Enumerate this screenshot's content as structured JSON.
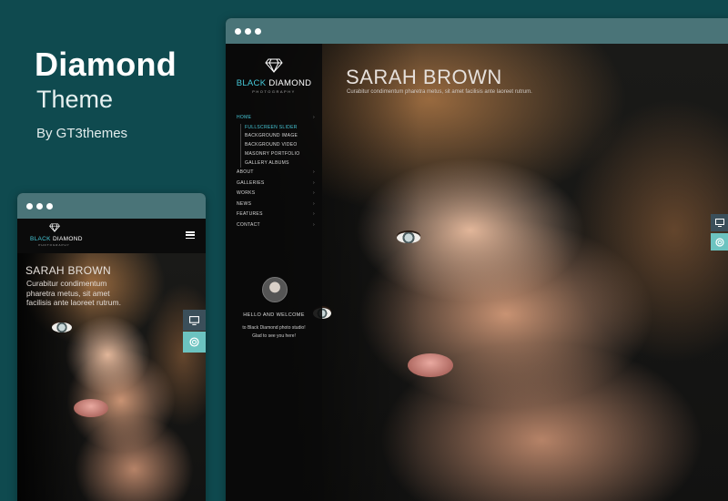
{
  "promo": {
    "title": "Diamond",
    "subtitle": "Theme",
    "author": "By GT3themes"
  },
  "site": {
    "logo_part1": "BLACK",
    "logo_part2": "DIAMOND",
    "logo_sub": "PHOTOGRAPHY",
    "hero_name": "SARAH BROWN",
    "hero_text": "Curabitur condimentum pharetra metus, sit amet facilisis ante laoreet rutrum."
  },
  "menu": {
    "home": "HOME",
    "submenu": [
      "FULLSCREEN SLIDER",
      "BACKGROUND IMAGE",
      "BACKGROUND VIDEO",
      "MASONRY PORTFOLIO",
      "GALLERY ALBUMS"
    ],
    "items": [
      "ABOUT",
      "GALLERIES",
      "WORKS",
      "NEWS",
      "FEATURES",
      "CONTACT"
    ],
    "chevron": "›"
  },
  "welcome": {
    "title": "HELLO AND WELCOME",
    "line1": "to Black Diamond photo studio!",
    "line2": "Glad to see you here!"
  },
  "colors": {
    "background": "#0f4a4f",
    "accent": "#46c8d8",
    "titlebar": "#4a7478"
  },
  "icons": {
    "desktop": "desktop-icon",
    "support": "lifebuoy-icon",
    "menu": "hamburger-icon",
    "logo": "diamond-icon"
  }
}
